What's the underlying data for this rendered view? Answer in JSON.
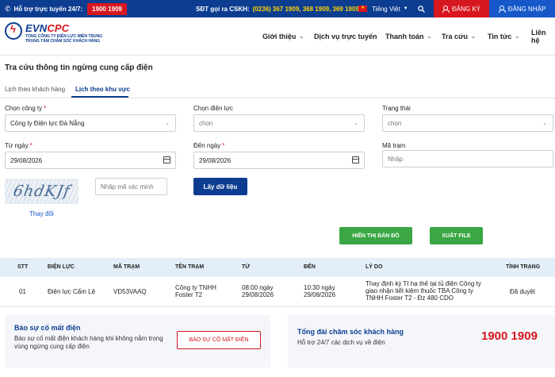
{
  "topbar": {
    "hotline_label": "Hỗ trợ trực tuyến 24/7:",
    "hotline_number": "1900 1909",
    "cskh_label": "SĐT gọi ra CSKH:",
    "cskh_numbers": "(0236) 367 1909, 368 1909, 369 1909",
    "language": "Tiếng Việt",
    "register": "ĐĂNG KÝ",
    "login": "ĐĂNG NHẬP"
  },
  "header": {
    "brand_a": "EVN",
    "brand_b": "CPC",
    "sub1": "TỔNG CÔNG TY ĐIỆN LỰC MIỀN TRUNG",
    "sub2": "TRUNG TÂM CHĂM SÓC KHÁCH HÀNG",
    "nav": [
      "Giới thiệu",
      "Dịch vụ trực tuyến",
      "Thanh toán",
      "Tra cứu",
      "Tin tức",
      "Liên hệ"
    ]
  },
  "page": {
    "title": "Tra cứu thông tin ngừng cung cấp điện",
    "tabs": [
      "Lịch theo khách hàng",
      "Lịch theo khu vực"
    ]
  },
  "form": {
    "company_label": "Chọn công ty",
    "company_value": "Công ty Điện lực Đà Nẵng",
    "branch_label": "Chọn điện lực",
    "branch_value": "chọn",
    "status_label": "Trạng thái",
    "status_value": "chọn",
    "from_label": "Từ ngày",
    "from_value": "29/08/2026",
    "to_label": "Đến ngày",
    "to_value": "29/08/2026",
    "station_label": "Mã trạm",
    "station_placeholder": "Nhập",
    "captcha_text": "6hdKJf",
    "captcha_placeholder": "Nhập mã xác minh",
    "refresh": "Thay đổi",
    "submit": "Lấy dữ liệu",
    "show_map": "HIỂN THỊ BẢN ĐỒ",
    "export": "XUẤT FILE"
  },
  "table": {
    "headers": [
      "STT",
      "ĐIỆN LỰC",
      "MÃ TRẠM",
      "TÊN TRẠM",
      "TỪ",
      "ĐẾN",
      "LÝ DO",
      "TÌNH TRẠNG"
    ],
    "rows": [
      {
        "stt": "01",
        "branch": "Điện lực Cẩm Lệ",
        "code": "VD53VAAQ",
        "name1": "Công ty TNHH",
        "name2": "Foster T2",
        "from1": "08:00 ngày",
        "from2": "29/08/2026",
        "to1": "10:30 ngày",
        "to2": "29/08/2026",
        "reason1": "Thay định kỳ TI hạ thế tại tủ điện Công ty",
        "reason2": "giao nhận tiết kiệm thuốc TBA Công ty",
        "reason3": "TNHH Foster T2 - Đz 480 CDO",
        "status": "Đã duyệt"
      }
    ]
  },
  "report": {
    "title": "Báo sự cố mất điện",
    "desc1": "Báo sự cố mất điện khách hàng khi không nằm trong",
    "desc2": "vùng ngừng cung cấp điện",
    "button": "BÁO SỰ CỐ MẤT ĐIỆN"
  },
  "support": {
    "title": "Tổng đài chăm sóc khách hàng",
    "desc": "Hỗ trợ 24/7 các dịch vụ về điện",
    "phone": "1900 1909"
  }
}
